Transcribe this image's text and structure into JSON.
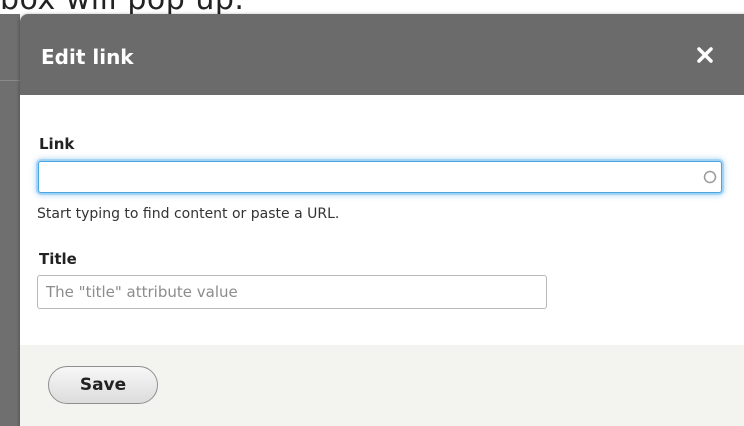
{
  "background": {
    "caption_fragment": "box will pop up."
  },
  "dialog": {
    "title": "Edit link",
    "close_icon": "close-icon"
  },
  "link_field": {
    "label": "Link",
    "value": "",
    "placeholder": "",
    "help_text": "Start typing to find content or paste a URL.",
    "icon": "autocomplete-throbber-icon"
  },
  "title_field": {
    "label": "Title",
    "value": "",
    "placeholder": "The \"title\" attribute value"
  },
  "footer": {
    "save_label": "Save"
  },
  "colors": {
    "header_bg": "#6b6b6b",
    "header_text": "#ffffff",
    "focus_ring": "#4aa6e0",
    "footer_bg": "#f3f3f0"
  }
}
